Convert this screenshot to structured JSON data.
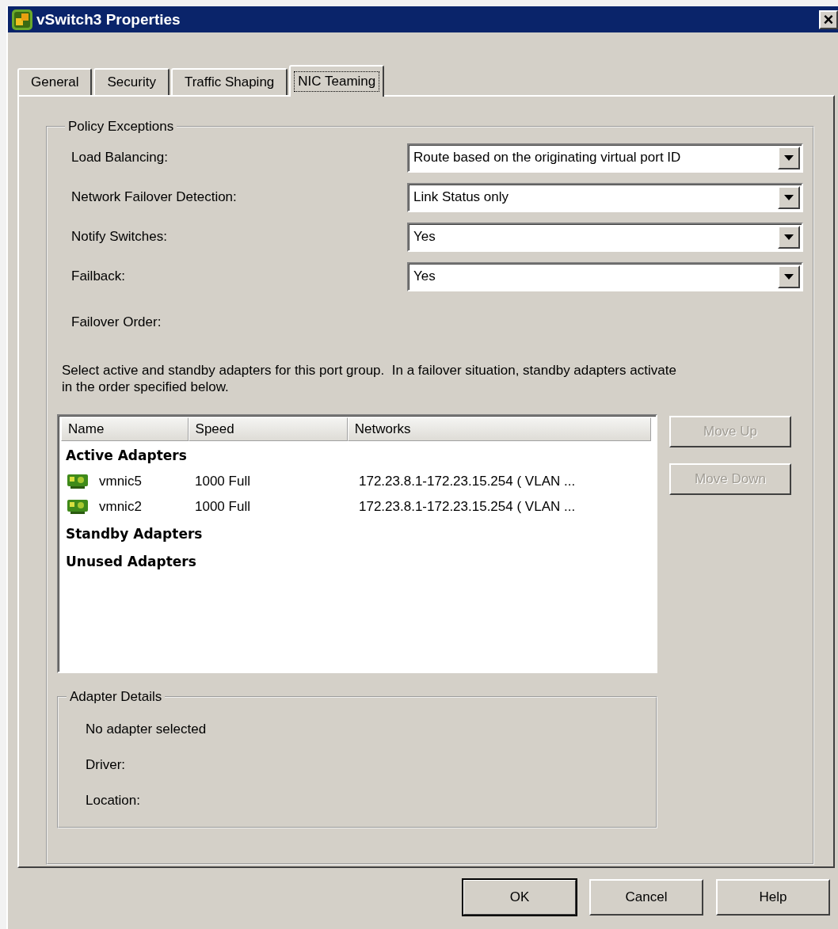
{
  "window": {
    "title": "vSwitch3 Properties",
    "close": "×"
  },
  "tabs": [
    {
      "label": "General",
      "selected": false
    },
    {
      "label": "Security",
      "selected": false
    },
    {
      "label": "Traffic Shaping",
      "selected": false
    },
    {
      "label": "NIC Teaming",
      "selected": true
    }
  ],
  "policy_exceptions": {
    "title": "Policy Exceptions",
    "fields": [
      {
        "label": "Load Balancing:",
        "value": "Route based on the originating virtual port ID"
      },
      {
        "label": "Network Failover Detection:",
        "value": "Link Status only"
      },
      {
        "label": "Notify Switches:",
        "value": "Yes"
      },
      {
        "label": "Failback:",
        "value": "Yes"
      }
    ]
  },
  "failover_order": {
    "label": "Failover Order:",
    "description": "Select active and standby adapters for this port group.  In a failover situation, standby adapters activate  in the order specified below.",
    "table": {
      "columns": [
        "Name",
        "Speed",
        "Networks"
      ],
      "groups": [
        {
          "title": "Active Adapters",
          "rows": [
            {
              "name": "vmnic5",
              "speed": "1000 Full",
              "networks": "172.23.8.1-172.23.15.254 ( VLAN ..."
            },
            {
              "name": "vmnic2",
              "speed": "1000 Full",
              "networks": "172.23.8.1-172.23.15.254 ( VLAN ..."
            }
          ]
        },
        {
          "title": "Standby Adapters"
        },
        {
          "title": "Unused Adapters"
        }
      ]
    },
    "buttons": [
      {
        "label": "Move Up",
        "disabled": true
      },
      {
        "label": "Move Down",
        "disabled": true
      }
    ]
  },
  "adapter_details": {
    "title": "Adapter Details",
    "lines": [
      "No adapter selected",
      "Driver:",
      "Location:"
    ]
  },
  "buttons": [
    {
      "label": "OK",
      "default": true
    },
    {
      "label": "Cancel",
      "default": false
    },
    {
      "label": "Help",
      "default": false
    }
  ]
}
